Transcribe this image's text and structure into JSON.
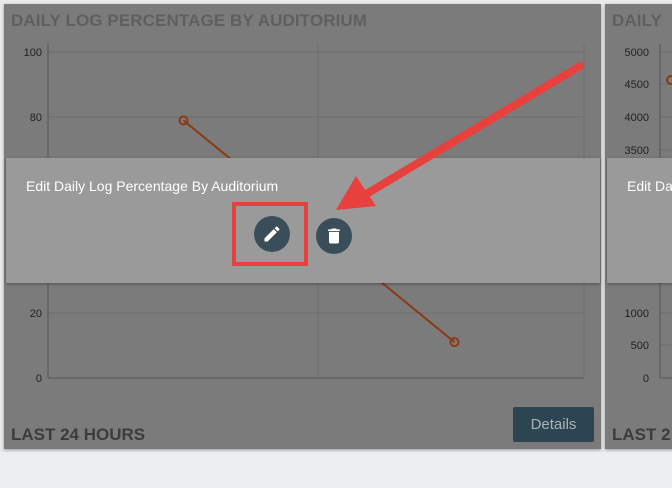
{
  "cards": [
    {
      "title": "DAILY LOG PERCENTAGE BY AUDITORIUM",
      "footer": "LAST 24 HOURS",
      "details_label": "Details",
      "overlay_title": "Edit Daily Log Percentage By Auditorium"
    },
    {
      "title": "DAILY",
      "footer": "LAST 2",
      "overlay_title": "Edit Dail"
    }
  ],
  "chart_data": [
    {
      "type": "line",
      "yticks": [
        "100",
        "80",
        "20",
        "0"
      ],
      "ylim": [
        0,
        100
      ],
      "series": [
        {
          "color": "#8a3a12",
          "points": [
            {
              "x": 1,
              "y": 79
            },
            {
              "x": 3,
              "y": 11
            }
          ]
        }
      ],
      "grid": true
    },
    {
      "type": "line",
      "yticks": [
        "5000",
        "4500",
        "4000",
        "3500",
        "1000",
        "500",
        "0"
      ],
      "ylim": [
        0,
        5000
      ],
      "grid": true
    }
  ],
  "icons": {
    "edit": "pencil-icon",
    "delete": "trash-icon"
  },
  "colors": {
    "annotation": "#e8403d",
    "button": "#3a4e59",
    "details_button": "#2d4552",
    "line": "#8a3a12"
  }
}
